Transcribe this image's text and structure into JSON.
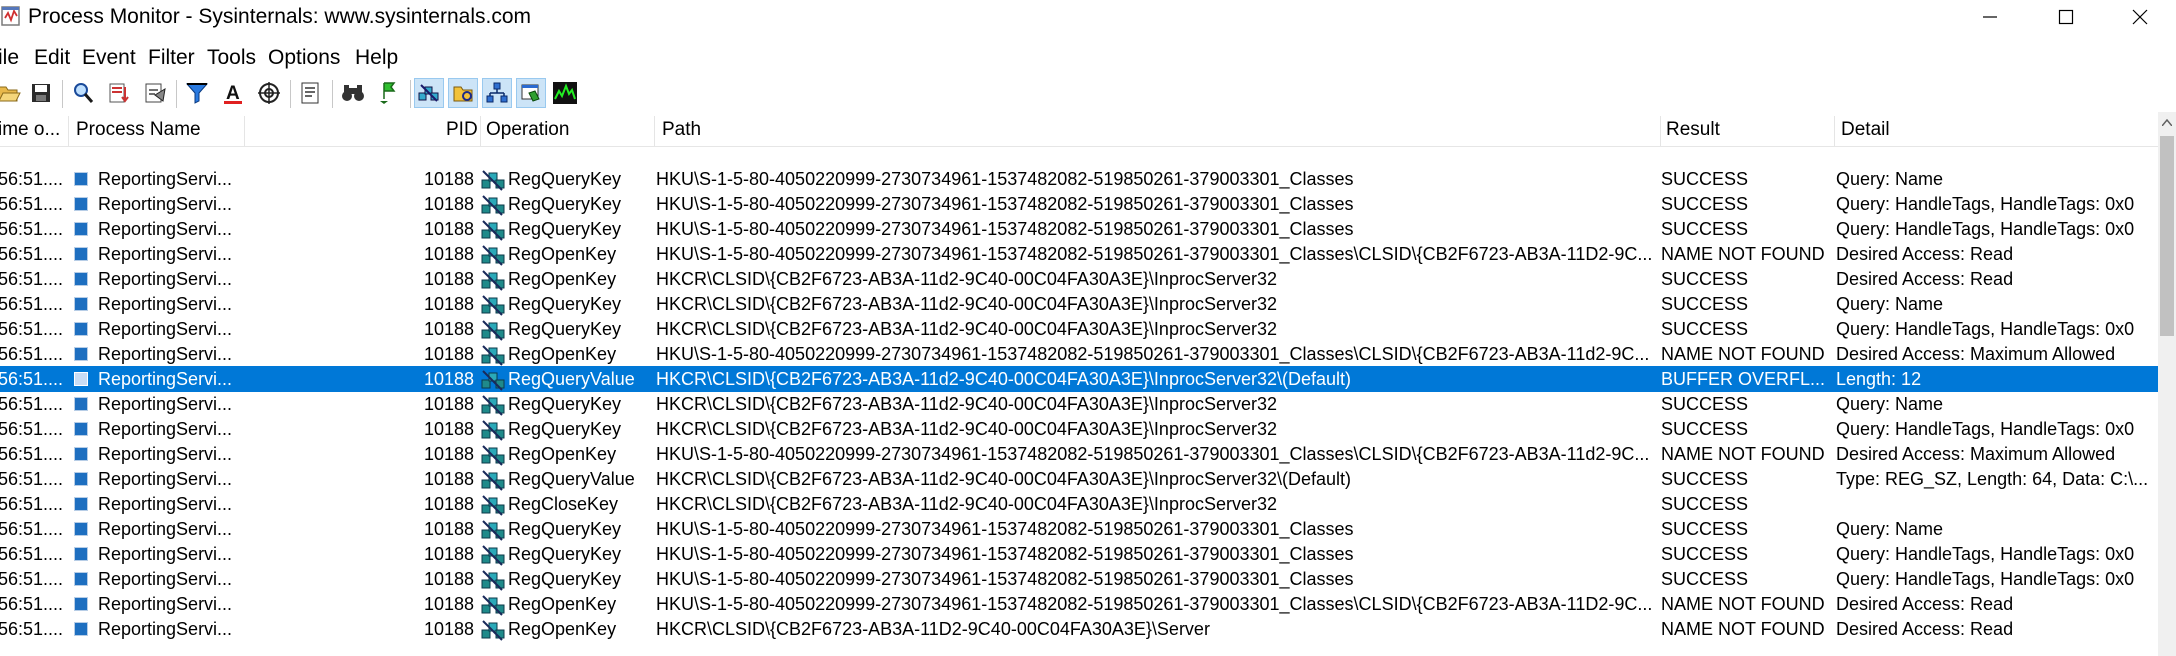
{
  "window": {
    "title": "Process Monitor - Sysinternals: www.sysinternals.com"
  },
  "menu": [
    "ile",
    "Edit",
    "Event",
    "Filter",
    "Tools",
    "Options",
    "Help"
  ],
  "toolbar": {
    "icons": [
      "open-icon",
      "save-icon",
      "magnify-icon",
      "autoscroll-icon",
      "clear-icon",
      "filter-icon",
      "highlight-icon",
      "target-icon",
      "tree-icon",
      "find-icon",
      "jump-icon",
      "registry-icon",
      "filesystem-icon",
      "network-icon",
      "process-icon",
      "profiling-icon"
    ]
  },
  "columns": {
    "time": "ime o...",
    "process": "Process Name",
    "pid": "PID",
    "operation": "Operation",
    "path": "Path",
    "result": "Result",
    "detail": "Detail"
  },
  "rows": [
    {
      "time": "56:51....",
      "process": "ReportingServi...",
      "pid": "10188",
      "operation": "RegQueryKey",
      "path": "HKU\\S-1-5-80-4050220999-2730734961-1537482082-519850261-379003301_Classes",
      "result": "SUCCESS",
      "detail": "Query: Name"
    },
    {
      "time": "56:51....",
      "process": "ReportingServi...",
      "pid": "10188",
      "operation": "RegQueryKey",
      "path": "HKU\\S-1-5-80-4050220999-2730734961-1537482082-519850261-379003301_Classes",
      "result": "SUCCESS",
      "detail": "Query: HandleTags, HandleTags: 0x0"
    },
    {
      "time": "56:51....",
      "process": "ReportingServi...",
      "pid": "10188",
      "operation": "RegQueryKey",
      "path": "HKU\\S-1-5-80-4050220999-2730734961-1537482082-519850261-379003301_Classes",
      "result": "SUCCESS",
      "detail": "Query: HandleTags, HandleTags: 0x0"
    },
    {
      "time": "56:51....",
      "process": "ReportingServi...",
      "pid": "10188",
      "operation": "RegOpenKey",
      "path": "HKU\\S-1-5-80-4050220999-2730734961-1537482082-519850261-379003301_Classes\\CLSID\\{CB2F6723-AB3A-11D2-9C...",
      "result": "NAME NOT FOUND",
      "detail": "Desired Access: Read"
    },
    {
      "time": "56:51....",
      "process": "ReportingServi...",
      "pid": "10188",
      "operation": "RegOpenKey",
      "path": "HKCR\\CLSID\\{CB2F6723-AB3A-11d2-9C40-00C04FA30A3E}\\InprocServer32",
      "result": "SUCCESS",
      "detail": "Desired Access: Read"
    },
    {
      "time": "56:51....",
      "process": "ReportingServi...",
      "pid": "10188",
      "operation": "RegQueryKey",
      "path": "HKCR\\CLSID\\{CB2F6723-AB3A-11d2-9C40-00C04FA30A3E}\\InprocServer32",
      "result": "SUCCESS",
      "detail": "Query: Name"
    },
    {
      "time": "56:51....",
      "process": "ReportingServi...",
      "pid": "10188",
      "operation": "RegQueryKey",
      "path": "HKCR\\CLSID\\{CB2F6723-AB3A-11d2-9C40-00C04FA30A3E}\\InprocServer32",
      "result": "SUCCESS",
      "detail": "Query: HandleTags, HandleTags: 0x0"
    },
    {
      "time": "56:51....",
      "process": "ReportingServi...",
      "pid": "10188",
      "operation": "RegOpenKey",
      "path": "HKU\\S-1-5-80-4050220999-2730734961-1537482082-519850261-379003301_Classes\\CLSID\\{CB2F6723-AB3A-11d2-9C...",
      "result": "NAME NOT FOUND",
      "detail": "Desired Access: Maximum Allowed"
    },
    {
      "time": "56:51....",
      "process": "ReportingServi...",
      "pid": "10188",
      "operation": "RegQueryValue",
      "path": "HKCR\\CLSID\\{CB2F6723-AB3A-11d2-9C40-00C04FA30A3E}\\InprocServer32\\(Default)",
      "result": "BUFFER OVERFL...",
      "detail": "Length: 12",
      "selected": true
    },
    {
      "time": "56:51....",
      "process": "ReportingServi...",
      "pid": "10188",
      "operation": "RegQueryKey",
      "path": "HKCR\\CLSID\\{CB2F6723-AB3A-11d2-9C40-00C04FA30A3E}\\InprocServer32",
      "result": "SUCCESS",
      "detail": "Query: Name"
    },
    {
      "time": "56:51....",
      "process": "ReportingServi...",
      "pid": "10188",
      "operation": "RegQueryKey",
      "path": "HKCR\\CLSID\\{CB2F6723-AB3A-11d2-9C40-00C04FA30A3E}\\InprocServer32",
      "result": "SUCCESS",
      "detail": "Query: HandleTags, HandleTags: 0x0"
    },
    {
      "time": "56:51....",
      "process": "ReportingServi...",
      "pid": "10188",
      "operation": "RegOpenKey",
      "path": "HKU\\S-1-5-80-4050220999-2730734961-1537482082-519850261-379003301_Classes\\CLSID\\{CB2F6723-AB3A-11d2-9C...",
      "result": "NAME NOT FOUND",
      "detail": "Desired Access: Maximum Allowed"
    },
    {
      "time": "56:51....",
      "process": "ReportingServi...",
      "pid": "10188",
      "operation": "RegQueryValue",
      "path": "HKCR\\CLSID\\{CB2F6723-AB3A-11d2-9C40-00C04FA30A3E}\\InprocServer32\\(Default)",
      "result": "SUCCESS",
      "detail": "Type: REG_SZ, Length: 64, Data: C:\\..."
    },
    {
      "time": "56:51....",
      "process": "ReportingServi...",
      "pid": "10188",
      "operation": "RegCloseKey",
      "path": "HKCR\\CLSID\\{CB2F6723-AB3A-11d2-9C40-00C04FA30A3E}\\InprocServer32",
      "result": "SUCCESS",
      "detail": ""
    },
    {
      "time": "56:51....",
      "process": "ReportingServi...",
      "pid": "10188",
      "operation": "RegQueryKey",
      "path": "HKU\\S-1-5-80-4050220999-2730734961-1537482082-519850261-379003301_Classes",
      "result": "SUCCESS",
      "detail": "Query: Name"
    },
    {
      "time": "56:51....",
      "process": "ReportingServi...",
      "pid": "10188",
      "operation": "RegQueryKey",
      "path": "HKU\\S-1-5-80-4050220999-2730734961-1537482082-519850261-379003301_Classes",
      "result": "SUCCESS",
      "detail": "Query: HandleTags, HandleTags: 0x0"
    },
    {
      "time": "56:51....",
      "process": "ReportingServi...",
      "pid": "10188",
      "operation": "RegQueryKey",
      "path": "HKU\\S-1-5-80-4050220999-2730734961-1537482082-519850261-379003301_Classes",
      "result": "SUCCESS",
      "detail": "Query: HandleTags, HandleTags: 0x0"
    },
    {
      "time": "56:51....",
      "process": "ReportingServi...",
      "pid": "10188",
      "operation": "RegOpenKey",
      "path": "HKU\\S-1-5-80-4050220999-2730734961-1537482082-519850261-379003301_Classes\\CLSID\\{CB2F6723-AB3A-11D2-9C...",
      "result": "NAME NOT FOUND",
      "detail": "Desired Access: Read"
    },
    {
      "time": "56:51....",
      "process": "ReportingServi...",
      "pid": "10188",
      "operation": "RegOpenKey",
      "path": "HKCR\\CLSID\\{CB2F6723-AB3A-11D2-9C40-00C04FA30A3E}\\Server",
      "result": "NAME NOT FOUND",
      "detail": "Desired Access: Read"
    }
  ],
  "colors": {
    "selection": "#0078d7",
    "registry_icon": "#1f8a8a"
  }
}
